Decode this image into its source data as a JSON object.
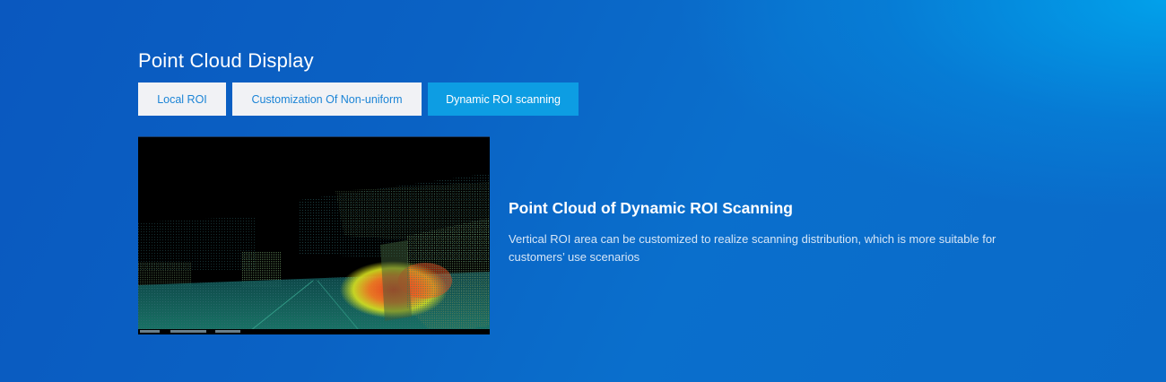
{
  "section": {
    "title": "Point Cloud Display"
  },
  "tabs": [
    {
      "label": "Local ROI",
      "active": false
    },
    {
      "label": "Customization Of Non-uniform",
      "active": false
    },
    {
      "label": "Dynamic ROI scanning",
      "active": true
    }
  ],
  "content": {
    "title": "Point Cloud of Dynamic ROI Scanning",
    "description": "Vertical ROI area can be customized to realize scanning distribution, which is more suitable for customers’ use scenarios"
  },
  "media": {
    "icon": "point-cloud-image"
  },
  "colors": {
    "tab_active_bg": "#0d9de3",
    "tab_inactive_bg": "#f1f2f5",
    "tab_inactive_text": "#1b84d6",
    "background_dark": "#0a58bf",
    "background_light": "#00aaf0"
  }
}
